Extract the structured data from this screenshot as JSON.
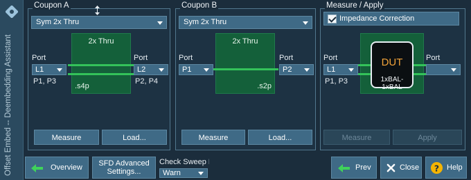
{
  "sidebar": {
    "title": "Offset Embed -- Deembedding Assistant"
  },
  "coupon_a": {
    "title": "Coupon A",
    "selection": "Sym 2x Thru",
    "port_label_left": "Port",
    "port_left_value": "L1",
    "port_left_ports": "P1, P3",
    "port_label_right": "Port",
    "port_right_value": "L2",
    "port_right_ports": "P2, P4",
    "box_title": "2x Thru",
    "box_file": ".s4p",
    "measure_label": "Measure",
    "load_label": "Load..."
  },
  "coupon_b": {
    "title": "Coupon B",
    "selection": "Sym 2x Thru",
    "port_label_left": "Port",
    "port_left_value": "P1",
    "port_label_right": "Port",
    "port_right_value": "P2",
    "box_title": "2x Thru",
    "box_file": ".s2p",
    "measure_label": "Measure",
    "load_label": "Load..."
  },
  "measure_apply": {
    "title": "Measure / Apply",
    "impedance_correction_label": "Impedance Correction",
    "impedance_correction_checked": true,
    "port_label_left": "Port",
    "port_left_value": "L1",
    "port_left_ports": "P1, P3",
    "port_label_right": "Port",
    "port_right_value": "",
    "dut_title": "DUT",
    "dut_subtitle": "1xBAL-1xBAL",
    "measure_label": "Measure",
    "apply_label": "Apply"
  },
  "bottom": {
    "overview_label": "Overview",
    "sfd_label_line1": "SFD Advanced",
    "sfd_label_line2": "Settings...",
    "check_sweep_label": "Check Sweep Pc",
    "check_sweep_value": "Warn",
    "prev_label": "Prev",
    "close_label": "Close",
    "help_label": "Help"
  },
  "colors": {
    "background": "#1b2d3c",
    "button": "#3f6a86",
    "box_green": "#14603a",
    "line_green": "#34c35a",
    "dut_text": "#f2a33a",
    "help_icon": "#f5b400"
  }
}
